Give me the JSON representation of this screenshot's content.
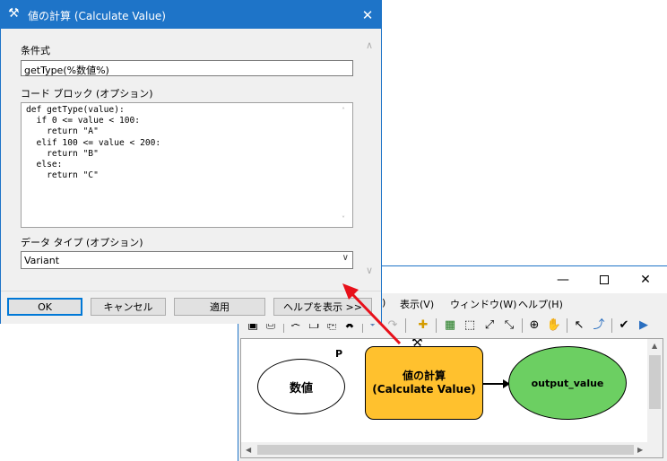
{
  "dialog": {
    "title": "値の計算 (Calculate Value)",
    "expression_label": "条件式",
    "expression_value": "getType(%数値%)",
    "code_block_label": "コード ブロック (オプション)",
    "code_block_value": "def getType(value):\n  if 0 <= value < 100:\n    return \"A\"\n  elif 100 <= value < 200:\n    return \"B\"\n  else:\n    return \"C\"",
    "data_type_label": "データ タイプ (オプション)",
    "data_type_value": "Variant",
    "buttons": {
      "ok": "OK",
      "cancel": "キャンセル",
      "apply": "適用",
      "help": "ヘルプを表示 >>"
    }
  },
  "modelbuilder": {
    "menu": {
      "hidden_item": ")",
      "view": "表示(V)",
      "window": "ウィンドウ(W)",
      "help": "ヘルプ(H)"
    },
    "nodes": {
      "input_variable": "数値",
      "parameter_badge": "P",
      "tool_name_jp": "値の計算",
      "tool_name_en": "(Calculate Value)",
      "output": "output_value"
    }
  },
  "colors": {
    "accent": "#1e74c8",
    "tool_fill": "#ffc12e",
    "output_fill": "#6ccf62",
    "annotation_arrow": "#e8101a"
  }
}
